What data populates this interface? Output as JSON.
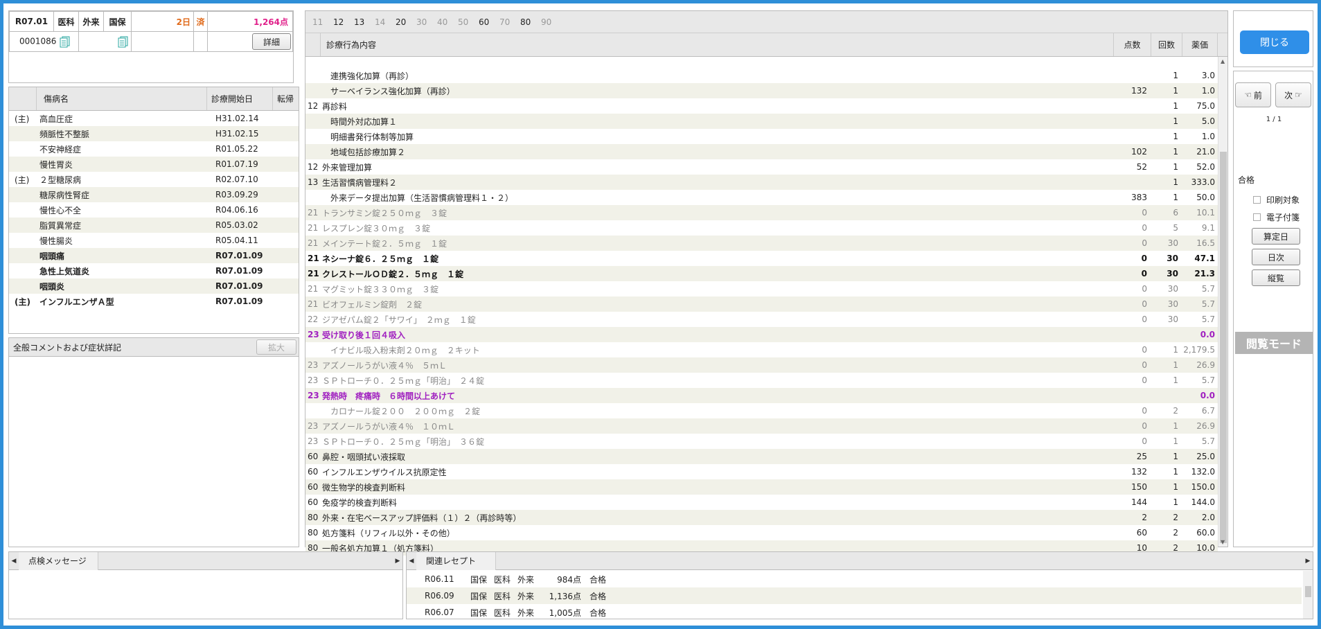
{
  "header": {
    "date": "R07.01",
    "dept": "医科",
    "visit_type": "外来",
    "insurance": "国保",
    "days": "2日",
    "status": "済",
    "points": "1,264点",
    "patient_id": "0001086",
    "detail_label": "詳細"
  },
  "disease": {
    "col_name": "傷病名",
    "col_start": "診療開始日",
    "col_outcome": "転帰",
    "rows": [
      {
        "main": "(主)",
        "name": "高血圧症",
        "date": "H31.02.14",
        "bold": false
      },
      {
        "main": "",
        "name": "頻脈性不整脈",
        "date": "H31.02.15",
        "bold": false
      },
      {
        "main": "",
        "name": "不安神経症",
        "date": "R01.05.22",
        "bold": false
      },
      {
        "main": "",
        "name": "慢性胃炎",
        "date": "R01.07.19",
        "bold": false
      },
      {
        "main": "(主)",
        "name": "２型糖尿病",
        "date": "R02.07.10",
        "bold": false
      },
      {
        "main": "",
        "name": "糖尿病性腎症",
        "date": "R03.09.29",
        "bold": false
      },
      {
        "main": "",
        "name": "慢性心不全",
        "date": "R04.06.16",
        "bold": false
      },
      {
        "main": "",
        "name": "脂質異常症",
        "date": "R05.03.02",
        "bold": false
      },
      {
        "main": "",
        "name": "慢性腸炎",
        "date": "R05.04.11",
        "bold": false
      },
      {
        "main": "",
        "name": "咽頭痛",
        "date": "R07.01.09",
        "bold": true
      },
      {
        "main": "",
        "name": "急性上気道炎",
        "date": "R07.01.09",
        "bold": true
      },
      {
        "main": "",
        "name": "咽頭炎",
        "date": "R07.01.09",
        "bold": true
      },
      {
        "main": "(主)",
        "name": "インフルエンザＡ型",
        "date": "R07.01.09",
        "bold": true
      }
    ]
  },
  "comment": {
    "title": "全般コメントおよび症状詳記",
    "expand_label": "拡大"
  },
  "tabs": [
    {
      "label": "11",
      "on": false
    },
    {
      "label": "12",
      "on": true
    },
    {
      "label": "13",
      "on": true
    },
    {
      "label": "14",
      "on": false
    },
    {
      "label": "20",
      "on": true
    },
    {
      "label": "30",
      "on": false
    },
    {
      "label": "40",
      "on": false
    },
    {
      "label": "50",
      "on": false
    },
    {
      "label": "60",
      "on": true
    },
    {
      "label": "70",
      "on": false
    },
    {
      "label": "80",
      "on": true
    },
    {
      "label": "90",
      "on": false
    }
  ],
  "grid": {
    "col_content": "診療行為内容",
    "col_points": "点数",
    "col_count": "回数",
    "col_price": "薬価",
    "rows": [
      {
        "code": "",
        "name": "　連携強化加算（再診）",
        "points": "",
        "count": "1",
        "price": "3.0",
        "style": ""
      },
      {
        "code": "",
        "name": "　サーベイランス強化加算（再診）",
        "points": "132",
        "count": "1",
        "price": "1.0",
        "style": ""
      },
      {
        "code": "12",
        "name": "再診料",
        "points": "",
        "count": "1",
        "price": "75.0",
        "style": ""
      },
      {
        "code": "",
        "name": "　時間外対応加算１",
        "points": "",
        "count": "1",
        "price": "5.0",
        "style": ""
      },
      {
        "code": "",
        "name": "　明細書発行体制等加算",
        "points": "",
        "count": "1",
        "price": "1.0",
        "style": ""
      },
      {
        "code": "",
        "name": "　地域包括診療加算２",
        "points": "102",
        "count": "1",
        "price": "21.0",
        "style": ""
      },
      {
        "code": "12",
        "name": "外来管理加算",
        "points": "52",
        "count": "1",
        "price": "52.0",
        "style": ""
      },
      {
        "code": "13",
        "name": "生活習慣病管理料２",
        "points": "",
        "count": "1",
        "price": "333.0",
        "style": ""
      },
      {
        "code": "",
        "name": "　外来データ提出加算（生活習慣病管理料１・２）",
        "points": "383",
        "count": "1",
        "price": "50.0",
        "style": ""
      },
      {
        "code": "21",
        "name": "トランサミン錠２５０ｍｇ　３錠",
        "points": "0",
        "count": "6",
        "price": "10.1",
        "style": "grey"
      },
      {
        "code": "21",
        "name": "レスプレン錠３０ｍｇ　３錠",
        "points": "0",
        "count": "5",
        "price": "9.1",
        "style": "grey"
      },
      {
        "code": "21",
        "name": "メインテート錠２．５ｍｇ　１錠",
        "points": "0",
        "count": "30",
        "price": "16.5",
        "style": "grey"
      },
      {
        "code": "21",
        "name": "ネシーナ錠６．２５ｍｇ　１錠",
        "points": "0",
        "count": "30",
        "price": "47.1",
        "style": "strong"
      },
      {
        "code": "21",
        "name": "クレストールＯＤ錠２．５ｍｇ　１錠",
        "points": "0",
        "count": "30",
        "price": "21.3",
        "style": "strong"
      },
      {
        "code": "21",
        "name": "マグミット錠３３０ｍｇ　３錠",
        "points": "0",
        "count": "30",
        "price": "5.7",
        "style": "grey"
      },
      {
        "code": "21",
        "name": "ビオフェルミン錠剤　２錠",
        "points": "0",
        "count": "30",
        "price": "5.7",
        "style": "grey"
      },
      {
        "code": "22",
        "name": "ジアゼパム錠２「サワイ」　２ｍｇ　１錠",
        "points": "0",
        "count": "30",
        "price": "5.7",
        "style": "grey"
      },
      {
        "code": "23",
        "name": "受け取り後１回４吸入",
        "points": "",
        "count": "",
        "price": "0.0",
        "style": "purple"
      },
      {
        "code": "",
        "name": "　イナビル吸入粉末剤２０ｍｇ　２キット",
        "points": "0",
        "count": "1",
        "price": "2,179.5",
        "style": "grey"
      },
      {
        "code": "23",
        "name": "アズノールうがい液４％　５ｍＬ",
        "points": "0",
        "count": "1",
        "price": "26.9",
        "style": "grey"
      },
      {
        "code": "23",
        "name": "ＳＰトローチ０．２５ｍｇ「明治」　２４錠",
        "points": "0",
        "count": "1",
        "price": "5.7",
        "style": "grey"
      },
      {
        "code": "23",
        "name": "発熱時　疼痛時　６時間以上あけて",
        "points": "",
        "count": "",
        "price": "0.0",
        "style": "purple"
      },
      {
        "code": "",
        "name": "　カロナール錠２００　２００ｍｇ　２錠",
        "points": "0",
        "count": "2",
        "price": "6.7",
        "style": "grey"
      },
      {
        "code": "23",
        "name": "アズノールうがい液４％　１０ｍＬ",
        "points": "0",
        "count": "1",
        "price": "26.9",
        "style": "grey"
      },
      {
        "code": "23",
        "name": "ＳＰトローチ０．２５ｍｇ「明治」　３６錠",
        "points": "0",
        "count": "1",
        "price": "5.7",
        "style": "grey"
      },
      {
        "code": "60",
        "name": "鼻腔・咽頭拭い液採取",
        "points": "25",
        "count": "1",
        "price": "25.0",
        "style": ""
      },
      {
        "code": "60",
        "name": "インフルエンザウイルス抗原定性",
        "points": "132",
        "count": "1",
        "price": "132.0",
        "style": ""
      },
      {
        "code": "60",
        "name": "微生物学的検査判断料",
        "points": "150",
        "count": "1",
        "price": "150.0",
        "style": ""
      },
      {
        "code": "60",
        "name": "免疫学的検査判断料",
        "points": "144",
        "count": "1",
        "price": "144.0",
        "style": ""
      },
      {
        "code": "80",
        "name": "外来・在宅ベースアップ評価料（１）２（再診時等）",
        "points": "2",
        "count": "2",
        "price": "2.0",
        "style": ""
      },
      {
        "code": "80",
        "name": "処方箋料（リフィル以外・その他）",
        "points": "60",
        "count": "2",
        "price": "60.0",
        "style": ""
      },
      {
        "code": "80",
        "name": "一般名処方加算１（処方箋料）",
        "points": "10",
        "count": "2",
        "price": "10.0",
        "style": ""
      }
    ]
  },
  "right": {
    "close_label": "閉じる",
    "prev_label": "前",
    "next_label": "次",
    "page": "1 / 1",
    "result": "合格",
    "print_label": "印刷対象",
    "attach_label": "電子付箋",
    "calc_day_label": "算定日",
    "daily_label": "日次",
    "vertical_label": "縦覧",
    "mode_label": "閲覧モード"
  },
  "message": {
    "title": "点検メッセージ"
  },
  "related": {
    "title": "関連レセプト",
    "rows": [
      {
        "date": "R06.11",
        "ins": "国保",
        "dept": "医科",
        "type": "外来",
        "points": "984点",
        "result": "合格"
      },
      {
        "date": "R06.09",
        "ins": "国保",
        "dept": "医科",
        "type": "外来",
        "points": "1,136点",
        "result": "合格"
      },
      {
        "date": "R06.07",
        "ins": "国保",
        "dept": "医科",
        "type": "外来",
        "points": "1,005点",
        "result": "合格"
      }
    ]
  },
  "colors": {
    "frame": "#2f8fd8",
    "close_button": "#2f8fe8",
    "accent_purple": "#a020c0",
    "points_pink": "#e0208a"
  }
}
